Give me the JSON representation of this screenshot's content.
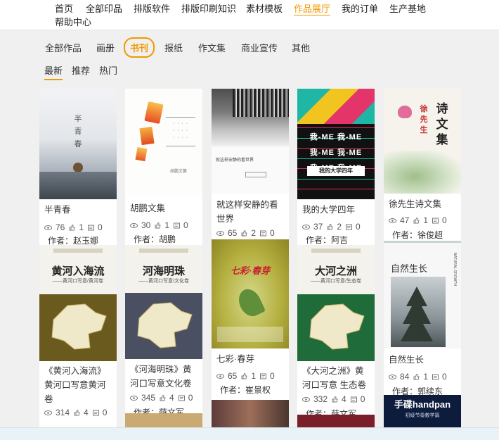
{
  "nav": {
    "items": [
      "首页",
      "全部印品",
      "排版软件",
      "排版印刷知识",
      "素材模板",
      "作品展厅",
      "我的订单",
      "生产基地",
      "帮助中心"
    ],
    "active": "作品展厅"
  },
  "categories": {
    "items": [
      "全部作品",
      "画册",
      "书刊",
      "报纸",
      "作文集",
      "商业宣传",
      "其他"
    ],
    "active": "书刊"
  },
  "sorts": {
    "items": [
      "最新",
      "推荐",
      "热门"
    ],
    "active": "最新"
  },
  "cards": [
    {
      "title": "半青春",
      "views": "76",
      "likes": "1",
      "comments": "0",
      "author": "作者：赵玉娜",
      "cover_text": "半\n青\n春"
    },
    {
      "title": "胡鹏文集",
      "views": "30",
      "likes": "1",
      "comments": "0",
      "author": "作者：胡鹏",
      "cover_text": "胡鹏文集"
    },
    {
      "title": "就这样安静的看世界",
      "views": "65",
      "likes": "2",
      "comments": "0",
      "author": "",
      "cover_text": "就这样安静的看世界"
    },
    {
      "title": "我的大学四年",
      "views": "37",
      "likes": "2",
      "comments": "0",
      "author": "作者：阿吉",
      "cover_text": "我的大学四年"
    },
    {
      "title": "徐先生诗文集",
      "views": "47",
      "likes": "1",
      "comments": "0",
      "author": "作者：徐俊超",
      "cover_text": "诗文集",
      "cover_text2": "徐先生"
    },
    {
      "title": "《黄河入海流》黄河口写意黄河卷",
      "views": "314",
      "likes": "4",
      "comments": "0",
      "author": "",
      "cover_text": "黄河入海流",
      "cover_sub": "——黄河口写意/黄河卷"
    },
    {
      "title": "《河海明珠》黄河口写意文化卷",
      "views": "345",
      "likes": "4",
      "comments": "0",
      "author": "作者：薛文军",
      "cover_text": "河海明珠",
      "cover_sub": "——黄河口写意/文化卷"
    },
    {
      "title": "七彩·春芽",
      "views": "65",
      "likes": "1",
      "comments": "0",
      "author": "作者：崔景权",
      "cover_text": "七彩·春芽"
    },
    {
      "title": "《大河之洲》黄河口写意 生态卷",
      "views": "332",
      "likes": "4",
      "comments": "0",
      "author": "作者：薛文军",
      "cover_text": "大河之洲",
      "cover_sub": "——黄河口写意/生态卷"
    },
    {
      "title": "自然生长",
      "views": "84",
      "likes": "1",
      "comments": "0",
      "author": "作者：郭续东",
      "cover_text": "自然生长",
      "cover_side": "NATURAL GROWTH"
    },
    {
      "title": "",
      "cover_text": "手碟handpan",
      "cover_sub": "初级节奏教学篇"
    }
  ],
  "colors": {
    "accent": "#f39800"
  }
}
